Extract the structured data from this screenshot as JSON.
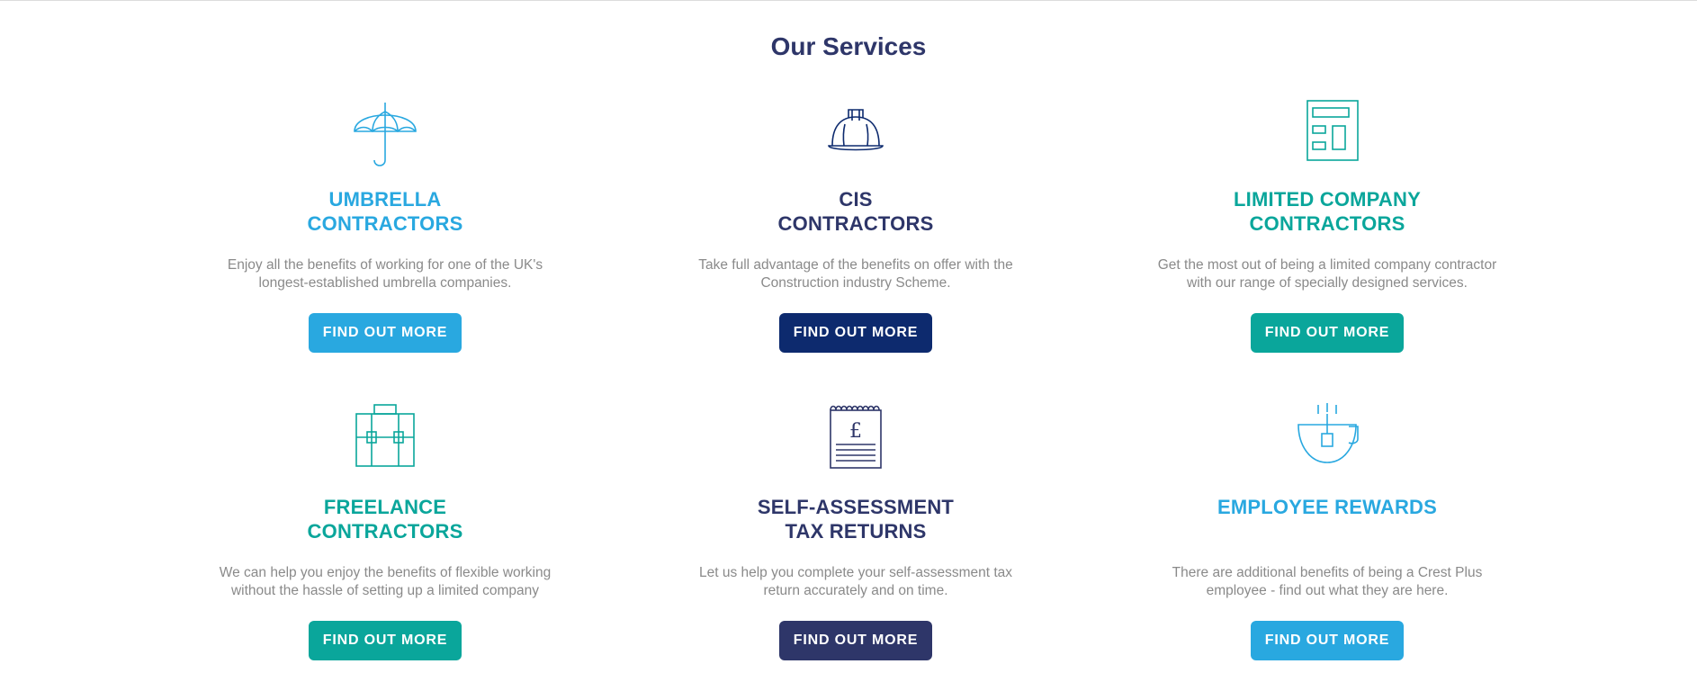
{
  "section_title": "Our Services",
  "colors": {
    "sky": "#29a8e0",
    "navy": "#0d2a6e",
    "slate": "#2e3669",
    "teal": "#0aa69b"
  },
  "services": [
    {
      "icon": "umbrella-icon",
      "heading_line1": "UMBRELLA",
      "heading_line2": "CONTRACTORS",
      "desc_line1": "Enjoy all the benefits of working for one of the UK's",
      "desc_line2": "longest-established umbrella companies.",
      "button_label": "FIND OUT MORE",
      "accent": "#29a8e0",
      "button_color": "#29a8e0"
    },
    {
      "icon": "hard-hat-icon",
      "heading_line1": "CIS",
      "heading_line2": "CONTRACTORS",
      "desc_line1": "Take full advantage of the benefits on offer with the",
      "desc_line2": "Construction industry Scheme.",
      "button_label": "FIND OUT MORE",
      "accent": "#2e3669",
      "button_color": "#0d2a6e"
    },
    {
      "icon": "calculator-icon",
      "heading_line1": "LIMITED COMPANY",
      "heading_line2": "CONTRACTORS",
      "desc_line1": "Get the most out of being a limited company contractor",
      "desc_line2": "with our range of specially designed services.",
      "button_label": "FIND OUT MORE",
      "accent": "#0aa69b",
      "button_color": "#0aa69b"
    },
    {
      "icon": "briefcase-icon",
      "heading_line1": "FREELANCE",
      "heading_line2": "CONTRACTORS",
      "desc_line1": "We can help you enjoy the benefits of flexible working",
      "desc_line2": "without the hassle of setting up a limited company",
      "button_label": "FIND OUT MORE",
      "accent": "#0aa69b",
      "button_color": "#0aa69b"
    },
    {
      "icon": "tax-receipt-icon",
      "heading_line1": "SELF-ASSESSMENT",
      "heading_line2": "TAX RETURNS",
      "desc_line1": "Let us help you complete your self-assessment tax",
      "desc_line2": "return accurately and on time.",
      "button_label": "FIND OUT MORE",
      "accent": "#2e3669",
      "button_color": "#2e3669"
    },
    {
      "icon": "tea-cup-icon",
      "heading_line1": "EMPLOYEE REWARDS",
      "heading_line2": "",
      "desc_line1": "There are additional benefits of being a Crest Plus",
      "desc_line2": "employee - find out what they are here.",
      "button_label": "FIND OUT MORE",
      "accent": "#29a8e0",
      "button_color": "#29a8e0"
    }
  ]
}
